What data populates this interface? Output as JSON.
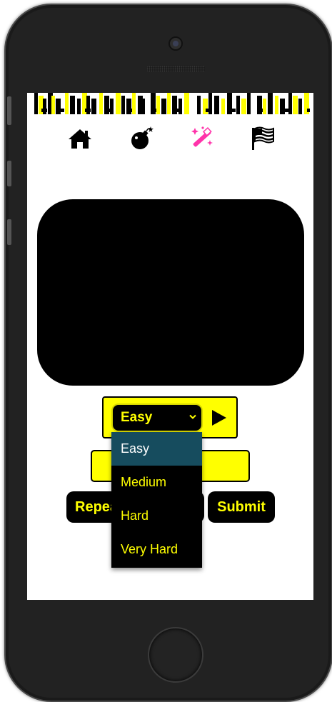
{
  "nav": {
    "icons": [
      "home-icon",
      "bomb-icon",
      "magic-wand-icon",
      "flag-icon"
    ],
    "active": "magic-wand-icon",
    "active_color": "#ff33aa"
  },
  "difficulty": {
    "selected": "Easy",
    "options": [
      "Easy",
      "Medium",
      "Hard",
      "Very Hard"
    ]
  },
  "answer_input": {
    "value": ""
  },
  "buttons": {
    "repeat_label": "Repeat",
    "submit_label": "Submit"
  },
  "theme": {
    "accent": "#ffff00",
    "dark": "#000000",
    "option_highlight": "#164c5e"
  }
}
